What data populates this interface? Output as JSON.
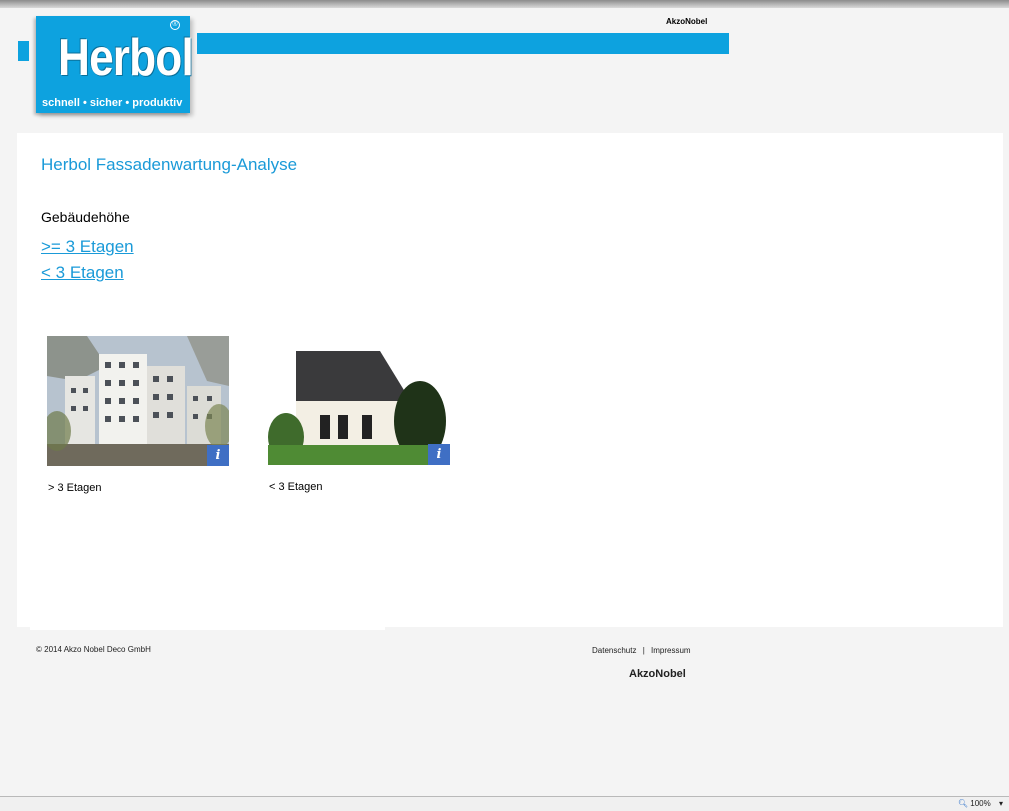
{
  "header": {
    "logo_text": "Herbol",
    "logo_registered": "®",
    "logo_slogan": "schnell • sicher • produktiv",
    "brand_top": "AkzoNobel",
    "accent_color": "#0da2df"
  },
  "main": {
    "title": "Herbol Fassadenwartung-Analyse",
    "section_label": "Gebäudehöhe",
    "links": [
      {
        "label": ">= 3 Etagen"
      },
      {
        "label": "< 3 Etagen"
      }
    ],
    "cards": [
      {
        "caption": "> 3 Etagen",
        "info_icon": "info-icon",
        "info_symbol": "i"
      },
      {
        "caption": "< 3 Etagen",
        "info_icon": "info-icon",
        "info_symbol": "i"
      }
    ]
  },
  "footer": {
    "copyright": "© 2014 Akzo Nobel Deco GmbH",
    "link_datenschutz": "Datenschutz",
    "separator": "|",
    "link_impressum": "Impressum",
    "brand": "AkzoNobel"
  },
  "statusbar": {
    "zoom": "100%",
    "zoom_dropdown": "▾"
  }
}
